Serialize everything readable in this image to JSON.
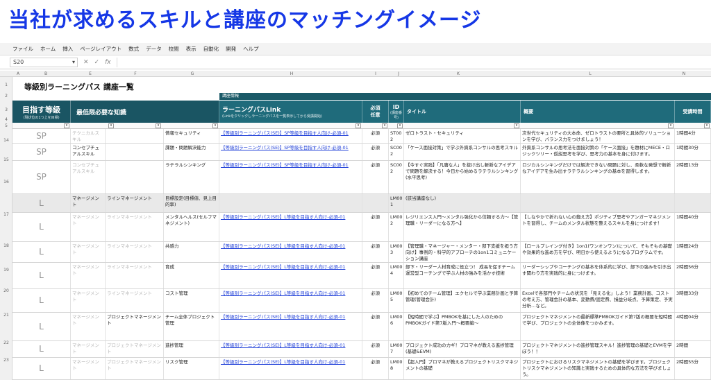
{
  "slide_title": "当社が求めるスキルと講座のマッチングイメージ",
  "ribbon": [
    "ファイル",
    "ホーム",
    "挿入",
    "ページレイアウト",
    "数式",
    "データ",
    "校閲",
    "表示",
    "自動化",
    "開発",
    "ヘルプ"
  ],
  "formula_bar": {
    "cell_ref": "S20",
    "fx": "fx"
  },
  "columns": [
    "A",
    "B",
    "E",
    "F",
    "G",
    "H",
    "I",
    "J",
    "K",
    "L",
    "N"
  ],
  "row_numbers": [
    "1",
    "2",
    "3",
    "4",
    "5",
    "14",
    "15",
    "16",
    "17",
    "18",
    "19",
    "20",
    "21",
    "22",
    "23"
  ],
  "sheet": {
    "title": "等級別ラーニングパス 講座一覧",
    "header_small": "講座情報",
    "headers": {
      "goal_grade": "目指す等級",
      "goal_grade_sub": "(現状位の1つ上を目標)",
      "knowledge": "最低限必要な知識",
      "link": "ラーニングパスLink",
      "link_sub": "(Linkをクリックしラーニングパスを一覧表示してから受講開始)",
      "required": "必須任意",
      "id": "ID",
      "id_sub": "(講座番号)",
      "title_col": "タイトル",
      "summary": "概要",
      "time": "受講時間"
    }
  },
  "rows": [
    {
      "grade": "SP",
      "cat1": "テクニカルスキル",
      "cat2": "",
      "skill": "情報セキュリティ",
      "link": "【等級別ラーニングパス(SE)】SP等級を目指す人向け-必須-01",
      "req": "必須",
      "id": "ST00 2",
      "title": "ゼロトラスト・セキュリティ",
      "summary": "次世代セキュリティの大本命、ゼロトラストの要所と具体的ソリューションを学び、バランス力をつけましょう！",
      "time": "1時間4分",
      "cat1_dim": true
    },
    {
      "grade": "SP",
      "cat1": "コンセプチュアルスキル",
      "cat2": "",
      "skill": "課題・問題解決能力",
      "link": "【等級別ラーニングパス(SE)】SP等級を目指す人向け-必須-01",
      "req": "必須",
      "id": "SC00 2",
      "title": "「ケース面接対策」で学ぶ外資系コンサルの思考スキル",
      "summary": "外資系コンサルの思考法を面接対策の「ケース面接」を題材にMECE・ロジックツリー・仮説思考を学び、思考力の基本を身に付けます。",
      "time": "1時間30分",
      "cat1_dim": false
    },
    {
      "grade": "SP",
      "cat1": "コンセプチュアルスキル",
      "cat2": "",
      "skill": "ラテラルシンキング",
      "link": "【等級別ラーニングパス(SE)】SP等級を目指す人向け-必須-01",
      "req": "必須",
      "id": "SC00 2",
      "title": "【今すぐ実践】「凡庸な人」を抜け出し斬新なアイデアで問題を解決する！今日から始めるラテラルシンキング(水平思考)",
      "summary": "ロジカルシンキングだけでは解決できない問題に対し、柔軟な発想で斬新なアイデアを生み出すラテラルシンキングの基本を習得します。",
      "time": "2時間13分",
      "cat1_dim": true
    },
    {
      "grade": "L",
      "cat1": "マネージメント",
      "cat2": "ラインマネージメント",
      "skill": "目標設定(目標値、見上目的率)",
      "link": "",
      "req": "",
      "id": "LM00 1",
      "title": "(該当講座なし)",
      "summary": "",
      "time": "",
      "gray": true
    },
    {
      "grade": "L",
      "cat1": "マネージメント",
      "cat2": "ラインマネージメント",
      "skill": "メンタルヘルス(セルフマネジメント)",
      "link": "【等級別ラーニングパス(SE)】L等級を目指す人向け-必須-01",
      "req": "必須",
      "id": "LM00 2",
      "title": "レジリエンス入門～メンタル強化から信頼する力～【管理職・リーダーになる方へ】",
      "summary": "【しなやかで折れない心の鍛え方】ポジティブ思考やアンガーマネジメントを習得し、チームのメンタル状態を整えるスキルを身につけます！",
      "time": "1時間40分",
      "dim": true
    },
    {
      "grade": "L",
      "cat1": "マネージメント",
      "cat2": "ラインマネージメント",
      "skill": "共感力",
      "link": "【等級別ラーニングパス(SE)】L等級を目指す人向け-必須-01",
      "req": "必須",
      "id": "LM00 3",
      "title": "【管理職・マネージャー・メンター・部下支援を担う方向け】事例的・科学的アプローチの1on1コミュニケーション講座",
      "summary": "【ロールプレイング付き】1on1(ワンオンワン)について、そもそもの基礎や効果的な進め方を学び、明日から使えるようになるプログラムです。",
      "time": "1時間24分",
      "dim": true
    },
    {
      "grade": "L",
      "cat1": "マネージメント",
      "cat2": "ラインマネージメント",
      "skill": "育成",
      "link": "【等級別ラーニングパス(SE)】L等級を目指す人向け-必須-01",
      "req": "必須",
      "id": "LM00 4",
      "title": "部下・リーダー人材育成に役立つ！ 成長を促すチーム運営型コーチングで学ぶ人材の強みを活かす技術",
      "summary": "リーダーシップやコーチングの基本を体系的に学び、部下の強みを引き出す関わり方を実践的に身につけます。",
      "time": "2時間56分",
      "dim": true
    },
    {
      "grade": "L",
      "cat1": "マネージメント",
      "cat2": "ラインマネージメント",
      "skill": "コスト管理",
      "link": "【等級別ラーニングパス(SE)】L等級を目指す人向け-必須-01",
      "req": "必須",
      "id": "LM00 5",
      "title": "【初めてのチーム管理】エクセルで学ぶ業務計画と予算管理(管理会計)",
      "summary": "Excelで各部門やチームの状況を「見える化」しよう！業務計画、コストの考え方、管理会計の基本、変動費/固定費、損益分岐点、予算策定、予実分析…など。",
      "time": "3時間33分",
      "dim": true
    },
    {
      "grade": "L",
      "cat1": "マネージメント",
      "cat2": "プロジェクトマネージメント",
      "skill": "チーム全体プロジェクト管理",
      "link": "【等級別ラーニングパス(SE)】L等級を目指す人向け-必須-01",
      "req": "必須",
      "id": "LM00 6",
      "title": "【短時間で学ぶ】PMBOKを基にした人のためのPMBOKガイド第7版入門～概要編～",
      "summary": "プロジェクトマネジメントの最新標準PMBOKガイド第7版の概要を短時間で学び、プロジェクトの全体像をつかみます。",
      "time": "4時間04分",
      "cat1_dim": true
    },
    {
      "grade": "L",
      "cat1": "マネージメント",
      "cat2": "プロジェクトマネージメント",
      "skill": "進捗管理",
      "link": "【等級別ラーニングパス(SE)】L等級を目指す人向け-必須-01",
      "req": "必須",
      "id": "LM00 7",
      "title": "プロジェクト成功の力ギ！プロマネが教える進捗管理(基礎&EVM)",
      "summary": "プロジェクトマネジメントの進捗管理スキル！進捗管理の基礎とEVMを学ぼう！！",
      "time": "2時間",
      "dim": true
    },
    {
      "grade": "L",
      "cat1": "マネージメント",
      "cat2": "プロジェクトマネージメント",
      "skill": "リスク管理",
      "link": "【等級別ラーニングパス(SE)】L等級を目指す人向け-必須-01",
      "req": "必須",
      "id": "LM00 8",
      "title": "【超入門】プロマネが教えるプロジェクトリスクマネジメントの基礎",
      "summary": "プロジェクトにおけるリスクマネジメントの基礎を学びます。プロジェクトリスクマネジメントの知識と実践するための具体的な方法を学びましょう。",
      "time": "2時間55分",
      "dim": true
    }
  ]
}
